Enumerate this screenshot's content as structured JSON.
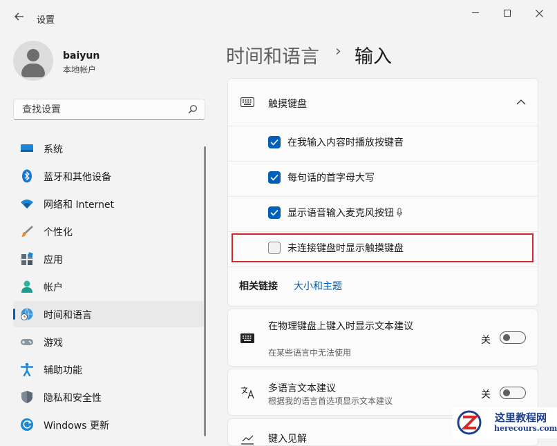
{
  "window": {
    "title": "设置",
    "icons": {
      "back": "back-arrow-icon",
      "minimize": "minimize-icon",
      "maximize": "maximize-icon",
      "close": "close-icon"
    }
  },
  "user": {
    "name": "baiyun",
    "account_type": "本地帐户"
  },
  "search": {
    "placeholder": "查找设置",
    "value": ""
  },
  "nav": {
    "items": [
      {
        "label": "系统",
        "icon": "system-display-icon",
        "selected": false
      },
      {
        "label": "蓝牙和其他设备",
        "icon": "bluetooth-icon",
        "selected": false
      },
      {
        "label": "网络和 Internet",
        "icon": "wifi-icon",
        "selected": false
      },
      {
        "label": "个性化",
        "icon": "paintbrush-icon",
        "selected": false
      },
      {
        "label": "应用",
        "icon": "apps-icon",
        "selected": false
      },
      {
        "label": "帐户",
        "icon": "account-icon",
        "selected": false
      },
      {
        "label": "时间和语言",
        "icon": "time-language-icon",
        "selected": true
      },
      {
        "label": "游戏",
        "icon": "gamepad-icon",
        "selected": false
      },
      {
        "label": "辅助功能",
        "icon": "accessibility-icon",
        "selected": false
      },
      {
        "label": "隐私和安全性",
        "icon": "shield-icon",
        "selected": false
      },
      {
        "label": "Windows 更新",
        "icon": "windows-update-icon",
        "selected": false
      }
    ]
  },
  "header": {
    "parent": "时间和语言",
    "separator": "›",
    "current": "输入"
  },
  "touch_keyboard": {
    "title": "触摸键盘",
    "expanded": true,
    "options": [
      {
        "label": "在我输入内容时播放按键音",
        "checked": true
      },
      {
        "label": "每句话的首字母大写",
        "checked": true
      },
      {
        "label": "显示语音输入麦克风按钮",
        "checked": true
      },
      {
        "label": "未连接键盘时显示触摸键盘",
        "checked": false
      }
    ],
    "related_label": "相关链接",
    "related_link": "大小和主题"
  },
  "physical_keyboard": {
    "title": "在物理键盘上键入时显示文本建议",
    "subtitle": "在某些语言中无法使用",
    "toggle_label": "关",
    "on": false
  },
  "multilingual": {
    "title": "多语言文本建议",
    "subtitle": "根据我的语言首选项显示文本建议",
    "toggle_label": "关",
    "on": false
  },
  "third_card": {
    "title": "键入见解"
  },
  "colors": {
    "accent": "#005fb8",
    "highlight_border": "#d9252a",
    "background": "#f3f3f3"
  },
  "watermark": {
    "name": "这里教程网",
    "url": "herecours.com"
  }
}
